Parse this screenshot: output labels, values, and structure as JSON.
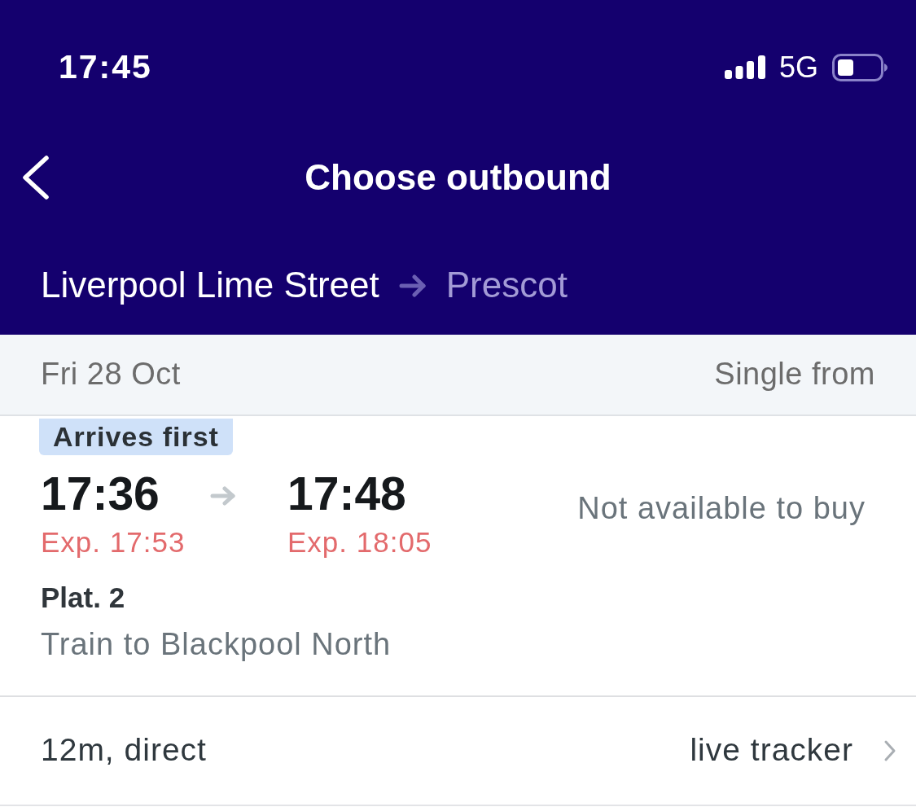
{
  "status_bar": {
    "time": "17:45",
    "network": "5G"
  },
  "nav": {
    "title": "Choose outbound"
  },
  "route": {
    "origin": "Liverpool Lime Street",
    "destination": "Prescot"
  },
  "date_bar": {
    "date": "Fri 28 Oct",
    "price_heading": "Single from"
  },
  "journeys": [
    {
      "badge": "Arrives first",
      "depart": "17:36",
      "arrive": "17:48",
      "depart_expected": "Exp. 17:53",
      "arrive_expected": "Exp. 18:05",
      "availability": "Not available to buy",
      "platform": "Plat. 2",
      "service": "Train to Blackpool North",
      "summary": "12m, direct",
      "link": "live tracker"
    }
  ]
}
